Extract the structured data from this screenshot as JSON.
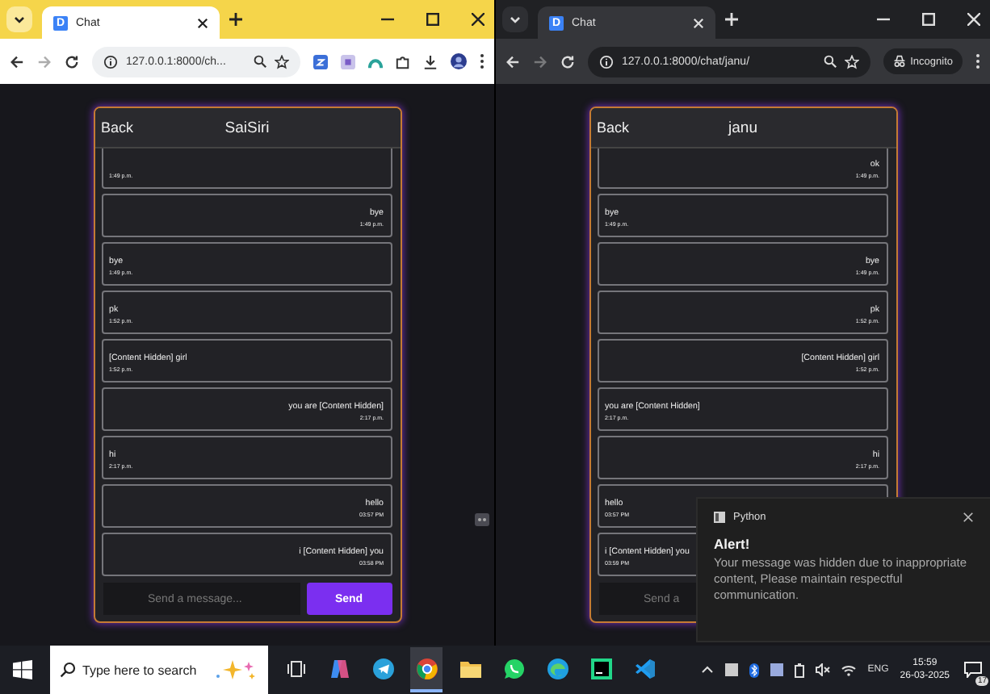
{
  "windows": [
    {
      "kind": "light",
      "tab": {
        "favicon_letter": "D",
        "title": "Chat"
      },
      "address": "127.0.0.1:8000/ch...",
      "chat": {
        "back": "Back",
        "title": "SaiSiri",
        "messages": [
          {
            "time": "1:49 p.m.",
            "sent": false
          },
          {
            "text": "bye",
            "time": "1:49 p.m.",
            "sent": true
          },
          {
            "text": "bye",
            "time": "1:49 p.m.",
            "sent": false
          },
          {
            "text": "pk",
            "time": "1:52 p.m.",
            "sent": false
          },
          {
            "text": "[Content Hidden] girl",
            "time": "1:52 p.m.",
            "sent": false
          },
          {
            "text": "you are [Content Hidden]",
            "time": "2:17 p.m.",
            "sent": true
          },
          {
            "text": "hi",
            "time": "2:17 p.m.",
            "sent": false
          },
          {
            "text": "hello",
            "time": "03:57 PM",
            "sent": true
          },
          {
            "text": "i [Content Hidden] you",
            "time": "03:58 PM",
            "sent": true
          }
        ],
        "input": {
          "placeholder": "Send a message..."
        },
        "send_button": "Send"
      }
    },
    {
      "kind": "dark",
      "tab": {
        "favicon_letter": "D",
        "title": "Chat"
      },
      "address": "127.0.0.1:8000/chat/janu/",
      "incognito": "Incognito",
      "chat": {
        "back": "Back",
        "title": "janu",
        "messages": [
          {
            "text": "ok",
            "time": "1:49 p.m.",
            "sent": true
          },
          {
            "text": "bye",
            "time": "1:49 p.m.",
            "sent": false
          },
          {
            "text": "bye",
            "time": "1:49 p.m.",
            "sent": true
          },
          {
            "text": "pk",
            "time": "1:52 p.m.",
            "sent": true
          },
          {
            "text": "[Content Hidden] girl",
            "time": "1:52 p.m.",
            "sent": true
          },
          {
            "text": "you are [Content Hidden]",
            "time": "2:17 p.m.",
            "sent": false
          },
          {
            "text": "hi",
            "time": "2:17 p.m.",
            "sent": true
          },
          {
            "text": "hello",
            "time": "03:57 PM",
            "sent": false
          },
          {
            "text": "i [Content Hidden] you",
            "time": "03:59 PM",
            "sent": false
          }
        ],
        "input": {
          "placeholder": "Send a"
        }
      }
    }
  ],
  "notification": {
    "app": "Python",
    "title": "Alert!",
    "body": "Your message was hidden due to inappropriate content, Please maintain respectful communication."
  },
  "taskbar": {
    "search_placeholder": "Type here to search",
    "apps": [
      {
        "kind": "taskview",
        "selected": false
      },
      {
        "kind": "copilot",
        "selected": false
      },
      {
        "kind": "telegram",
        "selected": false
      },
      {
        "kind": "chrome",
        "selected": true
      },
      {
        "kind": "folder",
        "selected": false
      },
      {
        "kind": "whatsapp",
        "selected": false
      },
      {
        "kind": "edge",
        "selected": false
      },
      {
        "kind": "pycharm",
        "selected": false
      },
      {
        "kind": "vscode",
        "selected": false
      }
    ],
    "language": "ENG",
    "time": "15:59",
    "date": "26-03-2025",
    "notification_count": "17"
  }
}
